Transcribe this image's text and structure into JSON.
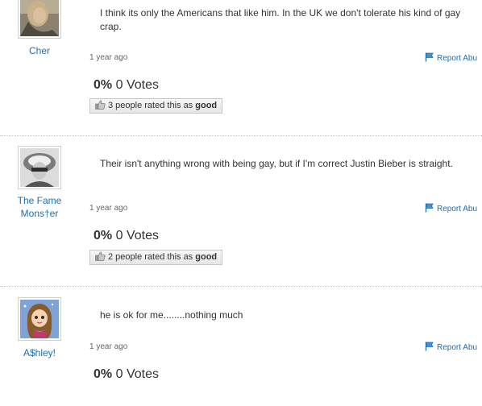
{
  "comments": [
    {
      "username": "Cher",
      "avatar_icon": "woman-photo-icon",
      "text": "I think its only the Americans that like him. In the UK we don't tolerate his kind of gay crap.",
      "time": "1 year ago",
      "report_label": "Report Abu",
      "vote_pct": "0%",
      "vote_label": "Votes",
      "vote_count": "0",
      "rated_prefix": "3 people rated this as",
      "rated_word": "good"
    },
    {
      "username": "The Fame Mons†er",
      "avatar_icon": "lady-gaga-photo-icon",
      "text": "Their isn't anything wrong with being gay, but if I'm correct Justin Bieber is straight.",
      "time": "1 year ago",
      "report_label": "Report Abu",
      "vote_pct": "0%",
      "vote_label": "Votes",
      "vote_count": "0",
      "rated_prefix": "2 people rated this as",
      "rated_word": "good"
    },
    {
      "username": "A$hley!",
      "avatar_icon": "cartoon-girl-avatar-icon",
      "text": "he is ok for me........nothing much",
      "time": "1 year ago",
      "report_label": "Report Abu",
      "vote_pct": "0%",
      "vote_label": "Votes",
      "vote_count": "0"
    }
  ],
  "colors": {
    "link": "#1a6fb5",
    "text": "#333333",
    "divider": "#c8c8c8"
  }
}
